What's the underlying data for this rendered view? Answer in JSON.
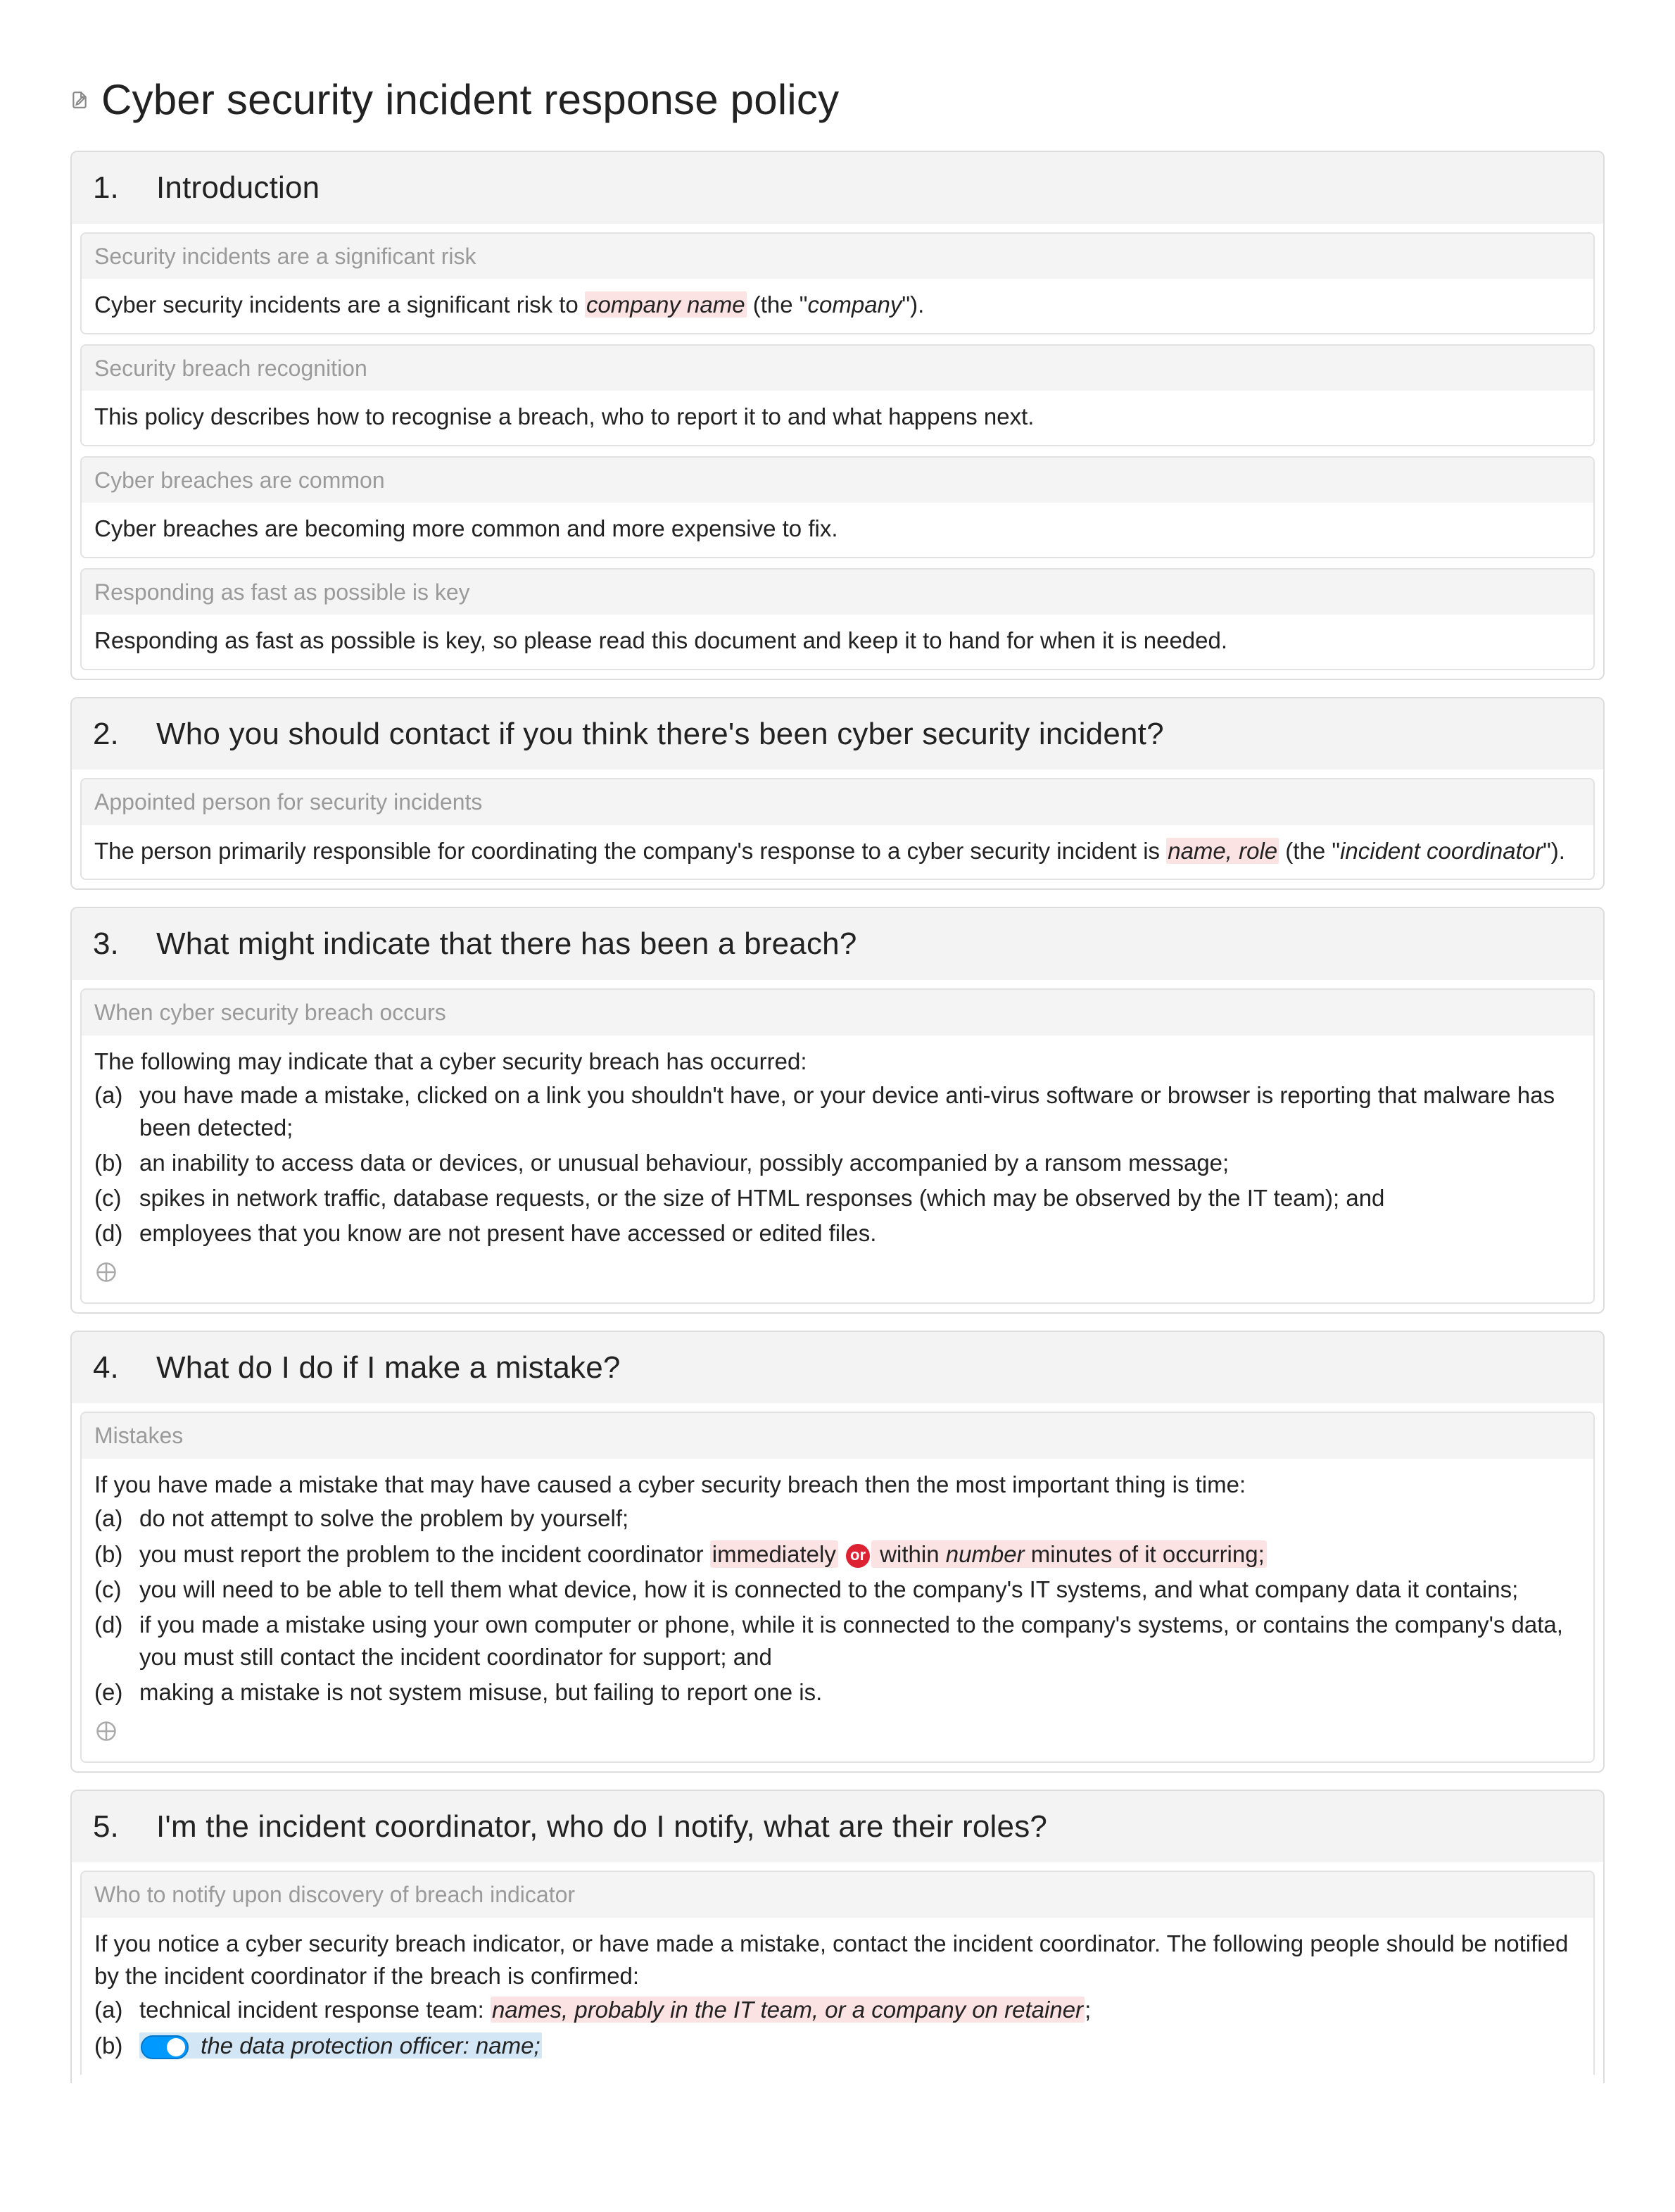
{
  "title": "Cyber security incident response policy",
  "sections": [
    {
      "num": "1.",
      "title": "Introduction",
      "clauses": [
        {
          "header": "Security incidents are a significant risk",
          "intro": "Cyber security incidents are a significant risk to ",
          "var1": "company name",
          "mid": " (the \"",
          "ital": "company",
          "end": "\")."
        },
        {
          "header": "Security breach recognition",
          "text": "This policy describes how to recognise a breach, who to report it to and what happens next."
        },
        {
          "header": "Cyber breaches are common",
          "text": "Cyber breaches are becoming more common and more expensive to fix."
        },
        {
          "header": "Responding as fast as possible is key",
          "text": "Responding as fast as possible is key, so please read this document and keep it to hand for when it is needed."
        }
      ]
    },
    {
      "num": "2.",
      "title": "Who you should contact if you think there's been cyber security incident?",
      "clauses": [
        {
          "header": "Appointed person for security incidents",
          "intro": "The person primarily responsible for coordinating the company's response to a cyber security incident is ",
          "var1": "name, role",
          "mid": " (the \"",
          "ital": "incident coordinator",
          "end": "\")."
        }
      ]
    },
    {
      "num": "3.",
      "title": "What might indicate that there has been a breach?",
      "clauses": [
        {
          "header": "When cyber security breach occurs",
          "lead": "The following may indicate that a cyber security breach has occurred:",
          "items": [
            {
              "m": "(a)",
              "t": "you have made a mistake, clicked on a link you shouldn't have, or your device anti-virus software or browser is reporting that malware has been detected;"
            },
            {
              "m": "(b)",
              "t": "an inability to access data or devices, or unusual behaviour, possibly accompanied by a ransom message;"
            },
            {
              "m": "(c)",
              "t": "spikes in network traffic, database requests, or the size of HTML responses (which may be observed by the IT team); and"
            },
            {
              "m": "(d)",
              "t": "employees that you know are not present have accessed or edited files."
            }
          ],
          "footer_icon": true
        }
      ]
    },
    {
      "num": "4.",
      "title": "What do I do if I make a mistake?",
      "clauses": [
        {
          "header": "Mistakes",
          "lead": "If you have made a mistake that may have caused a cyber security breach then the most important thing is time:",
          "items": [
            {
              "m": "(a)",
              "t": "do not attempt to solve the problem by yourself;"
            },
            {
              "m": "(b)",
              "pre": "you must report the problem to the incident coordinator ",
              "hl1": "immediately",
              "or": "or",
              "post1": " within ",
              "var": "number",
              "post2": " minutes of it occurring;"
            },
            {
              "m": "(c)",
              "t": "you will need to be able to tell them what device, how it is connected to the company's IT systems, and what company data it contains;"
            },
            {
              "m": "(d)",
              "t": "if you made a mistake using your own computer or phone, while it is connected to the company's systems, or contains the company's data, you must still contact the incident coordinator for support; and"
            },
            {
              "m": "(e)",
              "t": "making a mistake is not system misuse, but failing to report one is."
            }
          ],
          "footer_icon": true
        }
      ]
    },
    {
      "num": "5.",
      "title": "I'm the incident coordinator, who do I notify, what are their roles?",
      "clauses": [
        {
          "header": "Who to notify upon discovery of breach indicator",
          "lead": "If you notice a cyber security breach indicator, or have made a mistake, contact the incident coordinator. The following people should be notified by the incident coordinator if the breach is confirmed:",
          "items": [
            {
              "m": "(a)",
              "pre": "technical incident response team: ",
              "var": "names, probably in the IT team, or a company on retainer",
              "post": ";"
            },
            {
              "m": "(b)",
              "toggle": true,
              "pre": " the data protection officer: ",
              "bvar": "name",
              "post": ";"
            }
          ]
        }
      ]
    }
  ]
}
